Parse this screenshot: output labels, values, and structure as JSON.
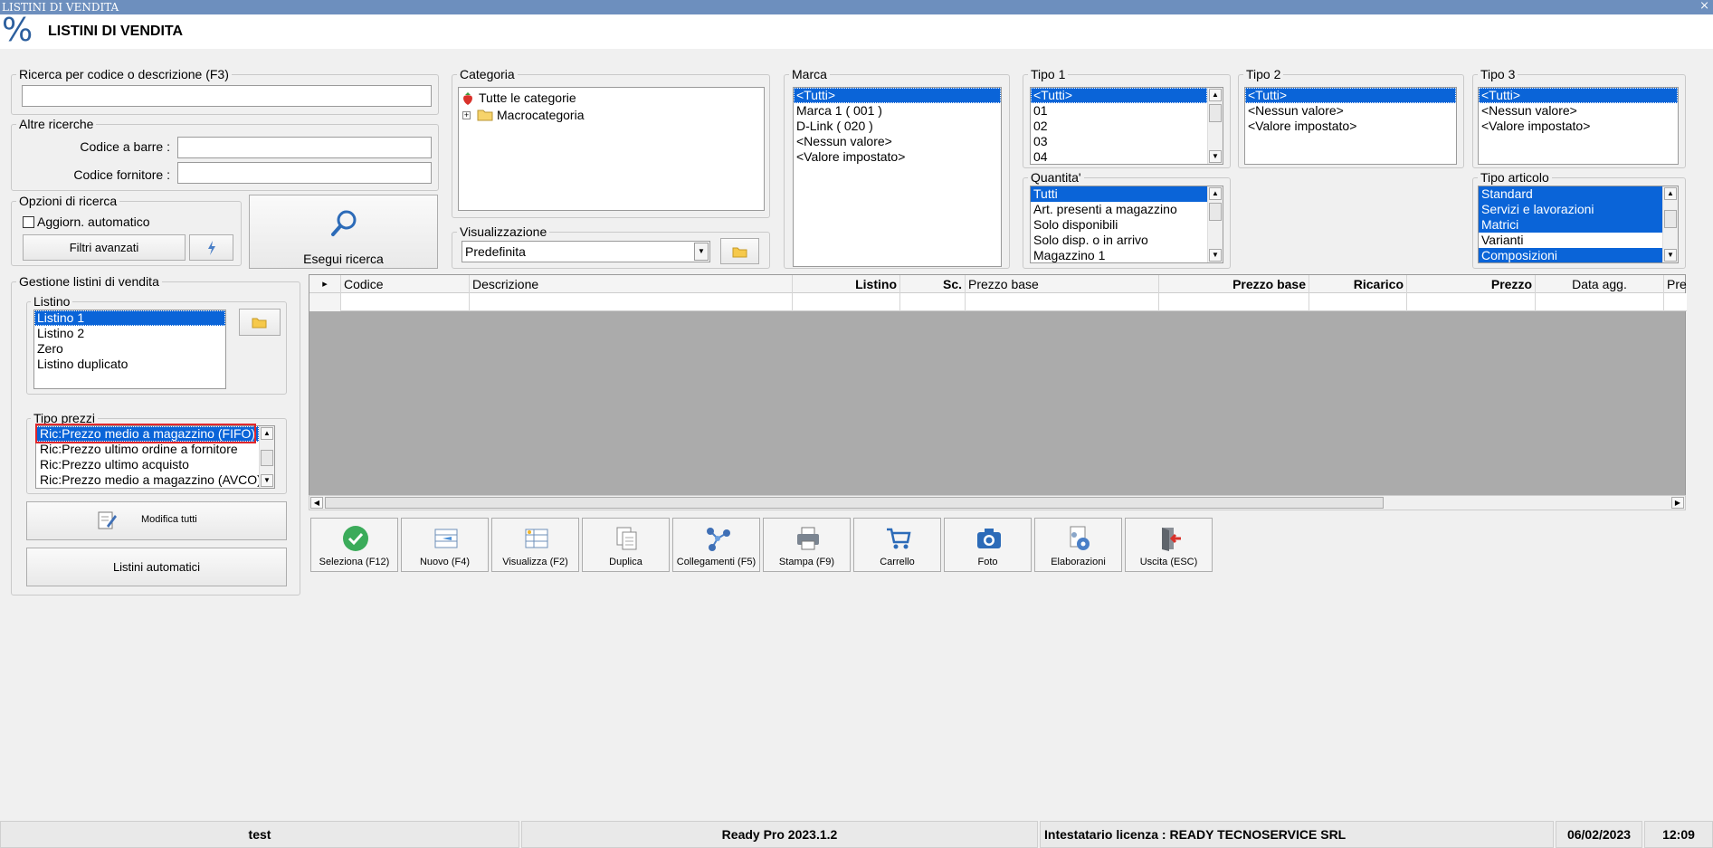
{
  "window": {
    "title": "LISTINI DI VENDITA",
    "close_glyph": "×"
  },
  "header": {
    "logo_glyph": "%",
    "title": "LISTINI DI VENDITA"
  },
  "ricerca": {
    "legend": "Ricerca per codice o descrizione (F3)",
    "value": ""
  },
  "altre": {
    "legend": "Altre ricerche",
    "barcode_label": "Codice a barre :",
    "barcode_value": "",
    "fornitore_label": "Codice fornitore :",
    "fornitore_value": ""
  },
  "opzioni": {
    "legend": "Opzioni di ricerca",
    "auto_label": "Aggiorn. automatico",
    "filtri_label": "Filtri avanzati"
  },
  "esegui": {
    "label": "Esegui ricerca"
  },
  "categoria": {
    "legend": "Categoria",
    "root": "Tutte le categorie",
    "child": "Macrocategoria",
    "expander": "+"
  },
  "visualizzazione": {
    "legend": "Visualizzazione",
    "value": "Predefinita"
  },
  "marca": {
    "legend": "Marca",
    "items": [
      "<Tutti>",
      "Marca 1 ( 001 )",
      "D-Link ( 020 )",
      "<Nessun valore>",
      "<Valore impostato>"
    ]
  },
  "tipo1": {
    "legend": "Tipo 1",
    "items": [
      "<Tutti>",
      "01",
      "02",
      "03",
      "04"
    ]
  },
  "tipo2": {
    "legend": "Tipo 2",
    "items": [
      "<Tutti>",
      "<Nessun valore>",
      "<Valore impostato>"
    ]
  },
  "tipo3": {
    "legend": "Tipo 3",
    "items": [
      "<Tutti>",
      "<Nessun valore>",
      "<Valore impostato>"
    ]
  },
  "quantita": {
    "legend": "Quantita'",
    "items": [
      "Tutti",
      "Art. presenti a magazzino",
      "Solo disponibili",
      "Solo disp. o in arrivo",
      "Magazzino 1"
    ]
  },
  "tipo_articolo": {
    "legend": "Tipo articolo",
    "items": [
      "Standard",
      "Servizi e lavorazioni",
      "Matrici",
      "Varianti",
      "Composizioni"
    ]
  },
  "gestione": {
    "legend": "Gestione listini di vendita"
  },
  "listino": {
    "legend": "Listino",
    "items": [
      "Listino 1",
      "Listino 2",
      "Zero",
      "Listino duplicato"
    ]
  },
  "tipo_prezzi": {
    "legend": "Tipo prezzi",
    "items": [
      "Ric:Prezzo medio a magazzino (FIFO)",
      "Ric:Prezzo ultimo ordine a fornitore",
      "Ric:Prezzo ultimo acquisto",
      "Ric:Prezzo medio a magazzino (AVCO) -"
    ]
  },
  "buttons": {
    "modifica_tutti": "Modifica tutti",
    "listini_automatici": "Listini automatici"
  },
  "grid": {
    "row_indicator": "▸",
    "columns": [
      "Codice",
      "Descrizione",
      "Listino",
      "Sc.",
      "Prezzo base",
      "Prezzo base",
      "Ricarico",
      "Prezzo",
      "Data agg.",
      "Pre"
    ]
  },
  "toolbar": [
    {
      "label": "Seleziona (F12)",
      "icon": "check-circle-icon"
    },
    {
      "label": "Nuovo (F4)",
      "icon": "new-row-icon"
    },
    {
      "label": "Visualizza (F2)",
      "icon": "grid-view-icon"
    },
    {
      "label": "Duplica",
      "icon": "duplicate-icon"
    },
    {
      "label": "Collegamenti (F5)",
      "icon": "links-icon"
    },
    {
      "label": "Stampa (F9)",
      "icon": "printer-icon"
    },
    {
      "label": "Carrello",
      "icon": "cart-icon"
    },
    {
      "label": "Foto",
      "icon": "camera-icon"
    },
    {
      "label": "Elaborazioni",
      "icon": "gear-doc-icon"
    },
    {
      "label": "Uscita (ESC)",
      "icon": "exit-door-icon"
    }
  ],
  "status": {
    "user": "test",
    "version": "Ready Pro 2023.1.2",
    "license": "Intestatario licenza : READY TECNOSERVICE SRL",
    "date": "06/02/2023",
    "time": "12:09"
  },
  "colors": {
    "selection": "#0a64d8",
    "title_bar": "#6d8fbe",
    "highlight_box": "#e0262b"
  }
}
